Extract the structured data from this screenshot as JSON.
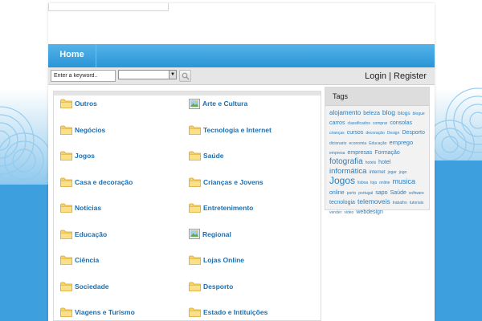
{
  "nav": {
    "home": "Home"
  },
  "search": {
    "keyword_placeholder": "Enter a keyword..",
    "select_value": ""
  },
  "auth": {
    "login": "Login",
    "separator": "|",
    "register": "Register"
  },
  "categories": [
    {
      "label": "Outros",
      "icon": "folder-icon"
    },
    {
      "label": "Arte e Cultura",
      "icon": "image-icon"
    },
    {
      "label": "Negócios",
      "icon": "folder-icon"
    },
    {
      "label": "Tecnologia e Internet",
      "icon": "folder-icon"
    },
    {
      "label": "Jogos",
      "icon": "folder-icon"
    },
    {
      "label": "Saúde",
      "icon": "folder-icon"
    },
    {
      "label": "Casa e decoração",
      "icon": "folder-icon"
    },
    {
      "label": "Crianças e Jovens",
      "icon": "folder-icon"
    },
    {
      "label": "Notícias",
      "icon": "folder-icon"
    },
    {
      "label": "Entretenimento",
      "icon": "folder-icon"
    },
    {
      "label": "Educação",
      "icon": "folder-icon"
    },
    {
      "label": "Regional",
      "icon": "image-icon"
    },
    {
      "label": "Ciência",
      "icon": "folder-icon"
    },
    {
      "label": "Lojas Online",
      "icon": "folder-icon"
    },
    {
      "label": "Sociedade",
      "icon": "folder-icon"
    },
    {
      "label": "Desporto",
      "icon": "folder-icon"
    },
    {
      "label": "Viagens e Turismo",
      "icon": "folder-icon"
    },
    {
      "label": "Estado e Intituições",
      "icon": "folder-icon"
    }
  ],
  "tags": {
    "title": "Tags",
    "items": [
      {
        "text": "alojamento",
        "size": 8
      },
      {
        "text": "beleza",
        "size": 7
      },
      {
        "text": "blog",
        "size": 8.5
      },
      {
        "text": "blogs",
        "size": 6.5
      },
      {
        "text": "blogue",
        "size": 5
      },
      {
        "text": "carros",
        "size": 7
      },
      {
        "text": "classificados",
        "size": 5
      },
      {
        "text": "comprar",
        "size": 5
      },
      {
        "text": "consolas",
        "size": 7
      },
      {
        "text": "crianças",
        "size": 5
      },
      {
        "text": "cursos",
        "size": 7
      },
      {
        "text": "decoração",
        "size": 5
      },
      {
        "text": "Design",
        "size": 5
      },
      {
        "text": "Desporto",
        "size": 7
      },
      {
        "text": "dicionario",
        "size": 5
      },
      {
        "text": "economia",
        "size": 5
      },
      {
        "text": "Educação",
        "size": 5
      },
      {
        "text": "emprego",
        "size": 7.5
      },
      {
        "text": "empresa",
        "size": 5
      },
      {
        "text": "empresas",
        "size": 7
      },
      {
        "text": "Formação",
        "size": 7
      },
      {
        "text": "fotografia",
        "size": 10
      },
      {
        "text": "hotels",
        "size": 5
      },
      {
        "text": "hotel",
        "size": 7
      },
      {
        "text": "informática",
        "size": 9.5
      },
      {
        "text": "internet",
        "size": 6
      },
      {
        "text": "jogar",
        "size": 5
      },
      {
        "text": "jogo",
        "size": 5
      },
      {
        "text": "Jogos",
        "size": 12
      },
      {
        "text": "lisboa",
        "size": 5
      },
      {
        "text": "loja",
        "size": 5
      },
      {
        "text": "online",
        "size": 5
      },
      {
        "text": "musica",
        "size": 9
      },
      {
        "text": "online",
        "size": 7
      },
      {
        "text": "porto",
        "size": 5
      },
      {
        "text": "portugal",
        "size": 5
      },
      {
        "text": "sapo",
        "size": 7
      },
      {
        "text": "Saúde",
        "size": 7
      },
      {
        "text": "software",
        "size": 5
      },
      {
        "text": "tecnologia",
        "size": 7
      },
      {
        "text": "telemoveis",
        "size": 8.5
      },
      {
        "text": "trabalho",
        "size": 5
      },
      {
        "text": "tutoriais",
        "size": 5
      },
      {
        "text": "vender",
        "size": 5
      },
      {
        "text": "video",
        "size": 5
      },
      {
        "text": "webdesign",
        "size": 7
      }
    ]
  },
  "colors": {
    "accent": "#2a95d6",
    "link": "#1a6fb1",
    "tag": "#2a7fc0",
    "folder": "#f5c84c"
  }
}
